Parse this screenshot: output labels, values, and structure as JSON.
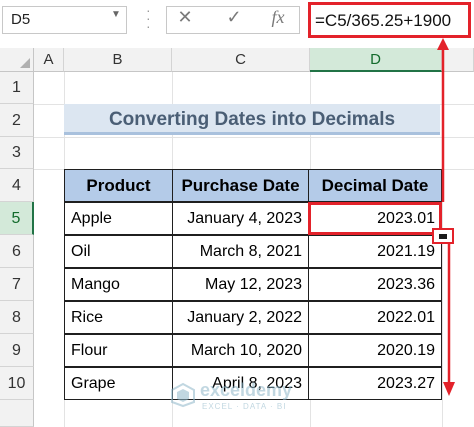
{
  "formula_bar": {
    "name_box": "D5",
    "cancel_icon": "✕",
    "enter_icon": "✓",
    "fx_label": "fx",
    "formula": "=C5/365.25+1900"
  },
  "columns": [
    "A",
    "B",
    "C",
    "D"
  ],
  "selected_column": "D",
  "rows": [
    "1",
    "2",
    "3",
    "4",
    "5",
    "6",
    "7",
    "8",
    "9",
    "10"
  ],
  "selected_row": "5",
  "title": "Converting Dates into Decimals",
  "table": {
    "headers": [
      "Product",
      "Purchase Date",
      "Decimal Date"
    ],
    "rows": [
      {
        "product": "Apple",
        "date": "January 4, 2023",
        "decimal": "2023.01"
      },
      {
        "product": "Oil",
        "date": "March 8, 2021",
        "decimal": "2021.19"
      },
      {
        "product": "Mango",
        "date": "May 12, 2023",
        "decimal": "2023.36"
      },
      {
        "product": "Rice",
        "date": "January 2, 2022",
        "decimal": "2022.01"
      },
      {
        "product": "Flour",
        "date": "March 10, 2020",
        "decimal": "2020.19"
      },
      {
        "product": "Grape",
        "date": "April 8, 2023",
        "decimal": "2023.27"
      }
    ]
  },
  "watermark": {
    "name": "exceldemy",
    "tagline": "EXCEL · DATA · BI"
  },
  "colors": {
    "highlight": "#e3222a",
    "header_fill": "#b4cbe8",
    "title_fill": "#dce6f1",
    "excel_green": "#217346"
  }
}
